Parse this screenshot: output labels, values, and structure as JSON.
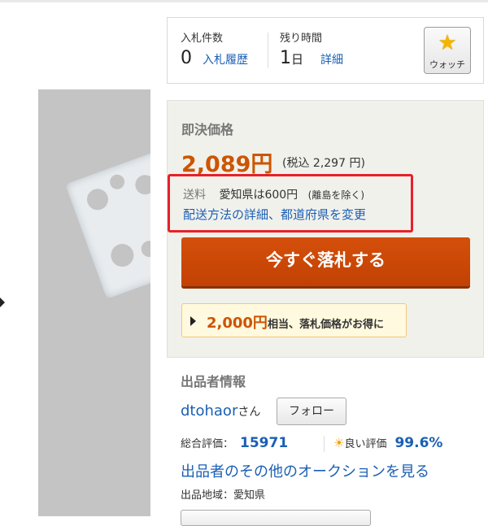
{
  "bid": {
    "count_label": "入札件数",
    "count_value": "0",
    "history_link": "入札履歴",
    "time_label": "残り時間",
    "time_value": "1",
    "time_unit": "日",
    "detail_link": "詳細",
    "watch_label": "ウォッチ",
    "watch_icon": "star-icon"
  },
  "price": {
    "title": "即決価格",
    "amount": "2,089円",
    "tax_note": "(税込 2,297 円)",
    "shipping_label": "送料",
    "shipping_text": "愛知県は600円",
    "shipping_note": "(離島を除く)",
    "shipping_link": "配送方法の詳細、都道府県を変更",
    "buy_button": "今すぐ落札する",
    "deal_amount": "2,000円",
    "deal_text": "相当、落札価格がお得に"
  },
  "seller": {
    "heading": "出品者情報",
    "name": "dtohaor",
    "name_suffix": "さん",
    "follow_button": "フォロー",
    "total_rating_label": "総合評価：",
    "total_rating_value": "15971",
    "good_rating_label": "良い評価",
    "good_rating_value": "99.6%",
    "other_auctions_link": "出品者のその他のオークションを見る",
    "region": "出品地域：愛知県"
  },
  "colors": {
    "price": "#cc5500",
    "buy_button": "#c84a06",
    "link": "#1a5fb4",
    "highlight_border": "#e8202a"
  }
}
